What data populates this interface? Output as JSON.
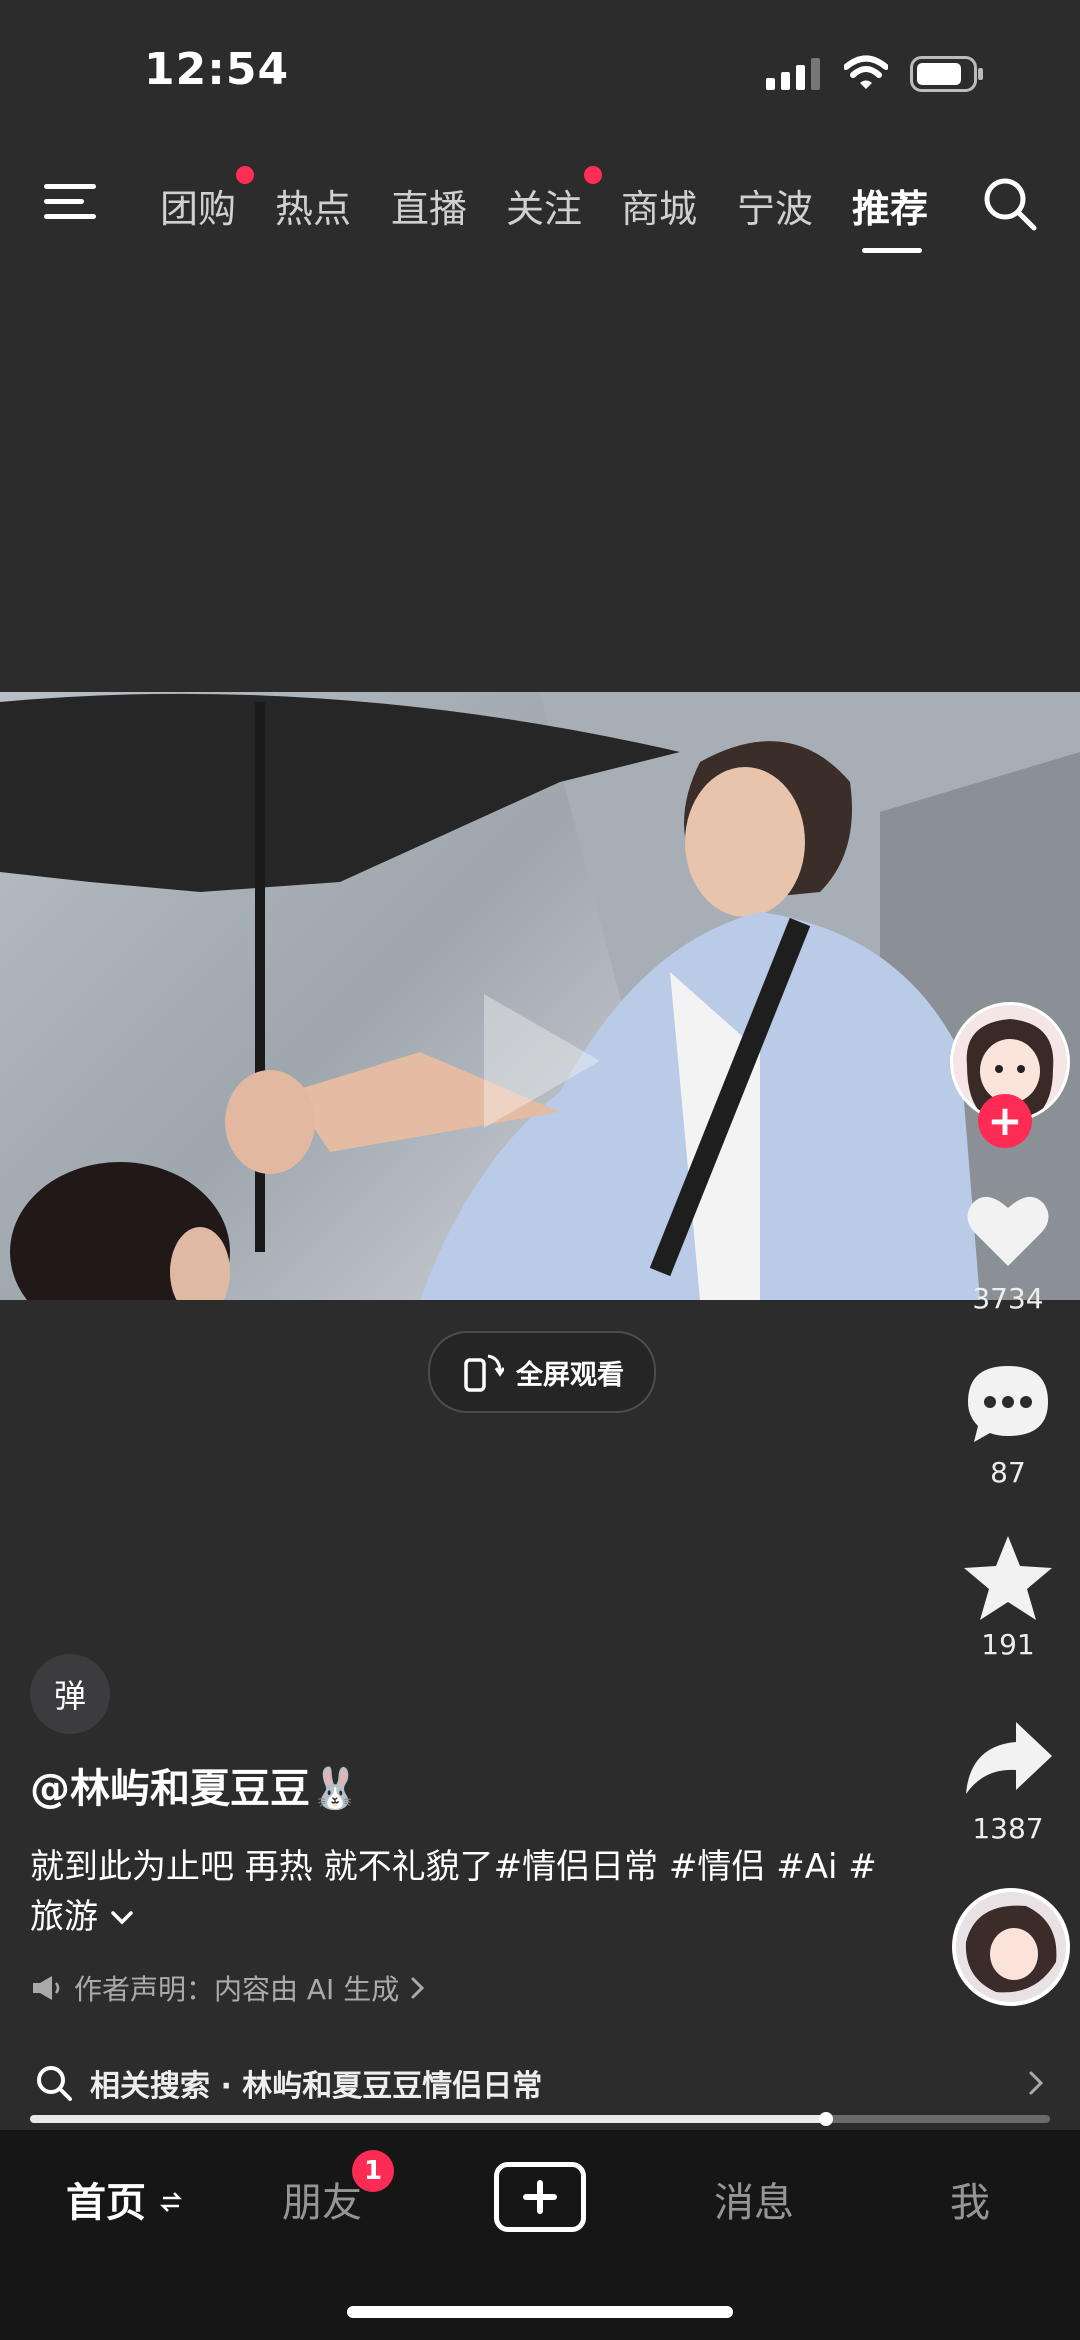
{
  "status_bar": {
    "time": "12:54"
  },
  "top_nav": {
    "tabs": [
      {
        "label": "团购",
        "has_dot": true
      },
      {
        "label": "热点",
        "has_dot": false
      },
      {
        "label": "直播",
        "has_dot": false
      },
      {
        "label": "关注",
        "has_dot": true
      },
      {
        "label": "商城",
        "has_dot": false
      },
      {
        "label": "宁波",
        "has_dot": false
      },
      {
        "label": "推荐",
        "active": true
      }
    ]
  },
  "video": {
    "fullscreen_label": "全屏观看"
  },
  "right_rail": {
    "likes": "3734",
    "comments": "87",
    "favorites": "191",
    "shares": "1387"
  },
  "post": {
    "danmaku_label": "弹",
    "author": "@林屿和夏豆豆🐰",
    "caption": "就到此为止吧  再热  就不礼貌了#情侣日常 #情侣 #Ai #旅游",
    "declaration": "作者声明：内容由 AI 生成",
    "related_search": "相关搜索 · 林屿和夏豆豆情侣日常",
    "progress": 0.78
  },
  "tab_bar": {
    "home": "首页",
    "friends": "朋友",
    "friends_badge": "1",
    "messages": "消息",
    "me": "我"
  },
  "colors": {
    "accent": "#fe2c55",
    "background": "#2c2c2d",
    "tabbar": "#161616"
  }
}
